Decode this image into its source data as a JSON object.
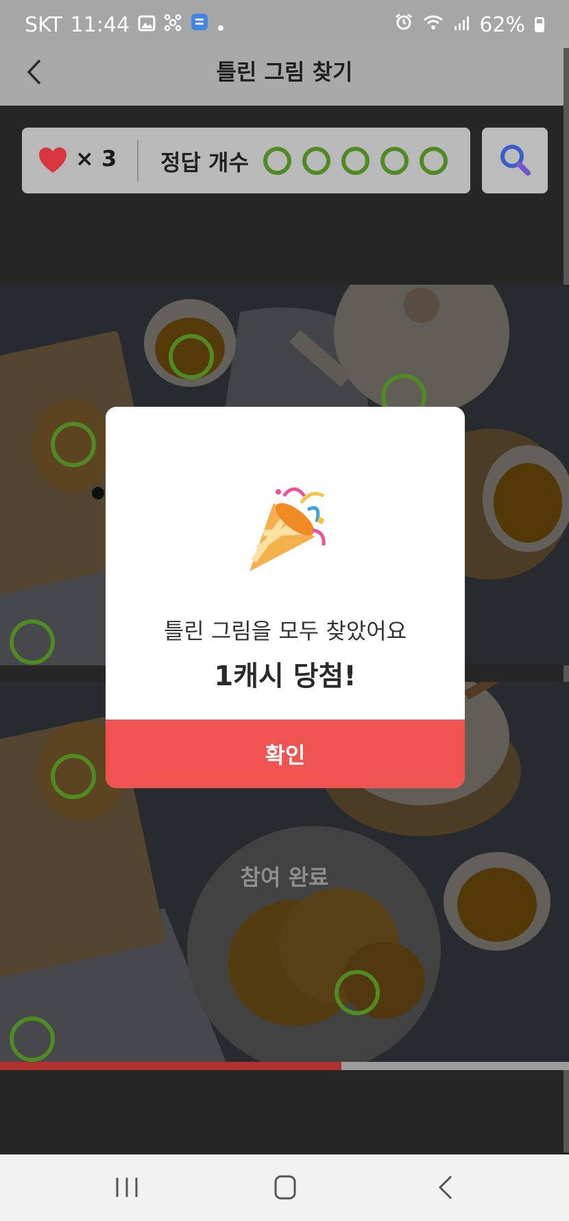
{
  "status_bar": {
    "carrier": "SKT",
    "time": "11:44",
    "battery": "62%"
  },
  "header": {
    "title": "틀린 그림 찾기"
  },
  "hud": {
    "lives": "× 3",
    "answer_label": "정답 개수",
    "answers_found": 5,
    "answers_total": 5
  },
  "game": {
    "status_text": "참여 완료",
    "progress": 0.6
  },
  "modal": {
    "message": "틀린 그림을 모두 찾았어요",
    "reward": "1캐시 당첨!",
    "confirm_label": "확인"
  },
  "icons": {
    "back": "chevron-left-icon",
    "hint": "search-icon",
    "heart": "heart-icon",
    "reward": "party-popper-icon"
  },
  "colors": {
    "accent": "#f05450",
    "found": "#4f8a22",
    "heart": "#d8353e",
    "progress": "#b0322f"
  }
}
